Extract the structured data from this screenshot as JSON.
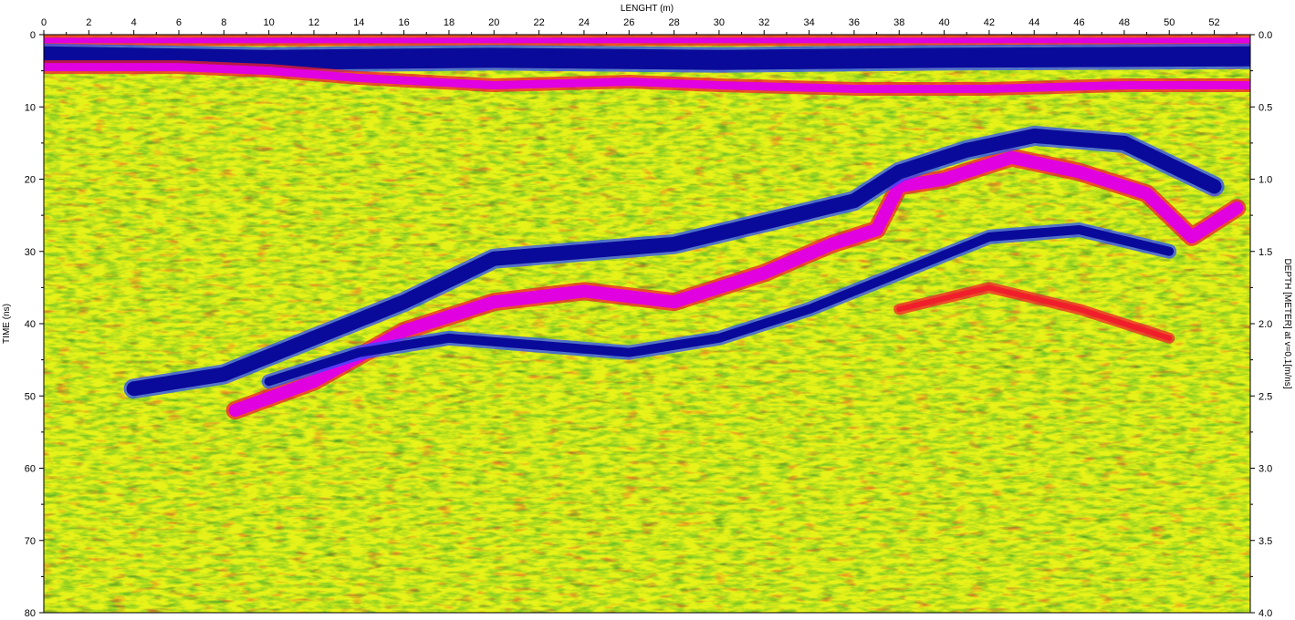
{
  "chart_data": {
    "type": "heatmap",
    "title": "",
    "xlabel": "LENGHT (m)",
    "ylabel_left": "TIME (ns)",
    "ylabel_right": "DEPTH [METER] at v=0,1[m/ns]",
    "xlim": [
      0,
      53.6
    ],
    "ylim_left": [
      0,
      80
    ],
    "ylim_right": [
      0.0,
      4.0
    ],
    "x_ticks": [
      "0",
      "2",
      "4",
      "6",
      "8",
      "10",
      "12",
      "14",
      "16",
      "18",
      "20",
      "22",
      "24",
      "26",
      "28",
      "30",
      "32",
      "34",
      "36",
      "38",
      "40",
      "42",
      "44",
      "46",
      "48",
      "50",
      "52"
    ],
    "y_ticks_left": [
      "0",
      "10",
      "20",
      "30",
      "40",
      "50",
      "60",
      "70",
      "80"
    ],
    "y_ticks_right": [
      "0.0",
      "0.5",
      "1.0",
      "1.5",
      "2.0",
      "2.5",
      "3.0",
      "3.5",
      "4.0"
    ],
    "colormap": [
      "#1b5e20",
      "#3fae2a",
      "#e6f218",
      "#f01e2a",
      "#e000e0",
      "#0a0a9a"
    ],
    "background_color": "#e6f218",
    "reflectors": [
      {
        "name": "surface",
        "color": "#e000e0",
        "x": [
          0,
          53.6
        ],
        "y": [
          0.8,
          0.8
        ]
      },
      {
        "name": "air-wave",
        "color": "#0a0a9a",
        "x": [
          0,
          10,
          20,
          30,
          40,
          53.6
        ],
        "y": [
          3,
          3.5,
          3.2,
          3.5,
          3.2,
          3
        ]
      },
      {
        "name": "shallow-layer",
        "color": "#e000e0",
        "x": [
          0,
          6,
          10,
          14,
          20,
          26,
          30,
          36,
          42,
          48,
          53.6
        ],
        "y": [
          4.5,
          4.5,
          5,
          6,
          7,
          6.5,
          7,
          7.5,
          7.5,
          7,
          7
        ]
      },
      {
        "name": "main-reflector",
        "color": "#e000e0",
        "x": [
          8.5,
          12,
          16,
          20,
          24,
          28,
          32,
          35,
          37,
          38,
          40,
          43,
          46,
          49,
          51,
          53
        ],
        "y": [
          52,
          48,
          41,
          37,
          35.5,
          37,
          33,
          29,
          27,
          21,
          20,
          17,
          19,
          22,
          28,
          24
        ]
      },
      {
        "name": "upper-dark-band",
        "color": "#0a0a9a",
        "x": [
          4,
          8,
          12,
          16,
          20,
          24,
          28,
          32,
          36,
          38,
          41,
          44,
          48,
          52
        ],
        "y": [
          49,
          47,
          42,
          37,
          31,
          30,
          29,
          26,
          23,
          19,
          16,
          14,
          15,
          21
        ]
      },
      {
        "name": "lower-dark-band",
        "color": "#0a0a9a",
        "x": [
          10,
          14,
          18,
          22,
          26,
          30,
          34,
          38,
          42,
          46,
          50
        ],
        "y": [
          48,
          44,
          42,
          43,
          44,
          42,
          38,
          33,
          28,
          27,
          30
        ]
      },
      {
        "name": "deep-reflector",
        "color": "#f01e2a",
        "x": [
          38,
          42,
          46,
          50
        ],
        "y": [
          38,
          35,
          38,
          42
        ]
      }
    ]
  }
}
